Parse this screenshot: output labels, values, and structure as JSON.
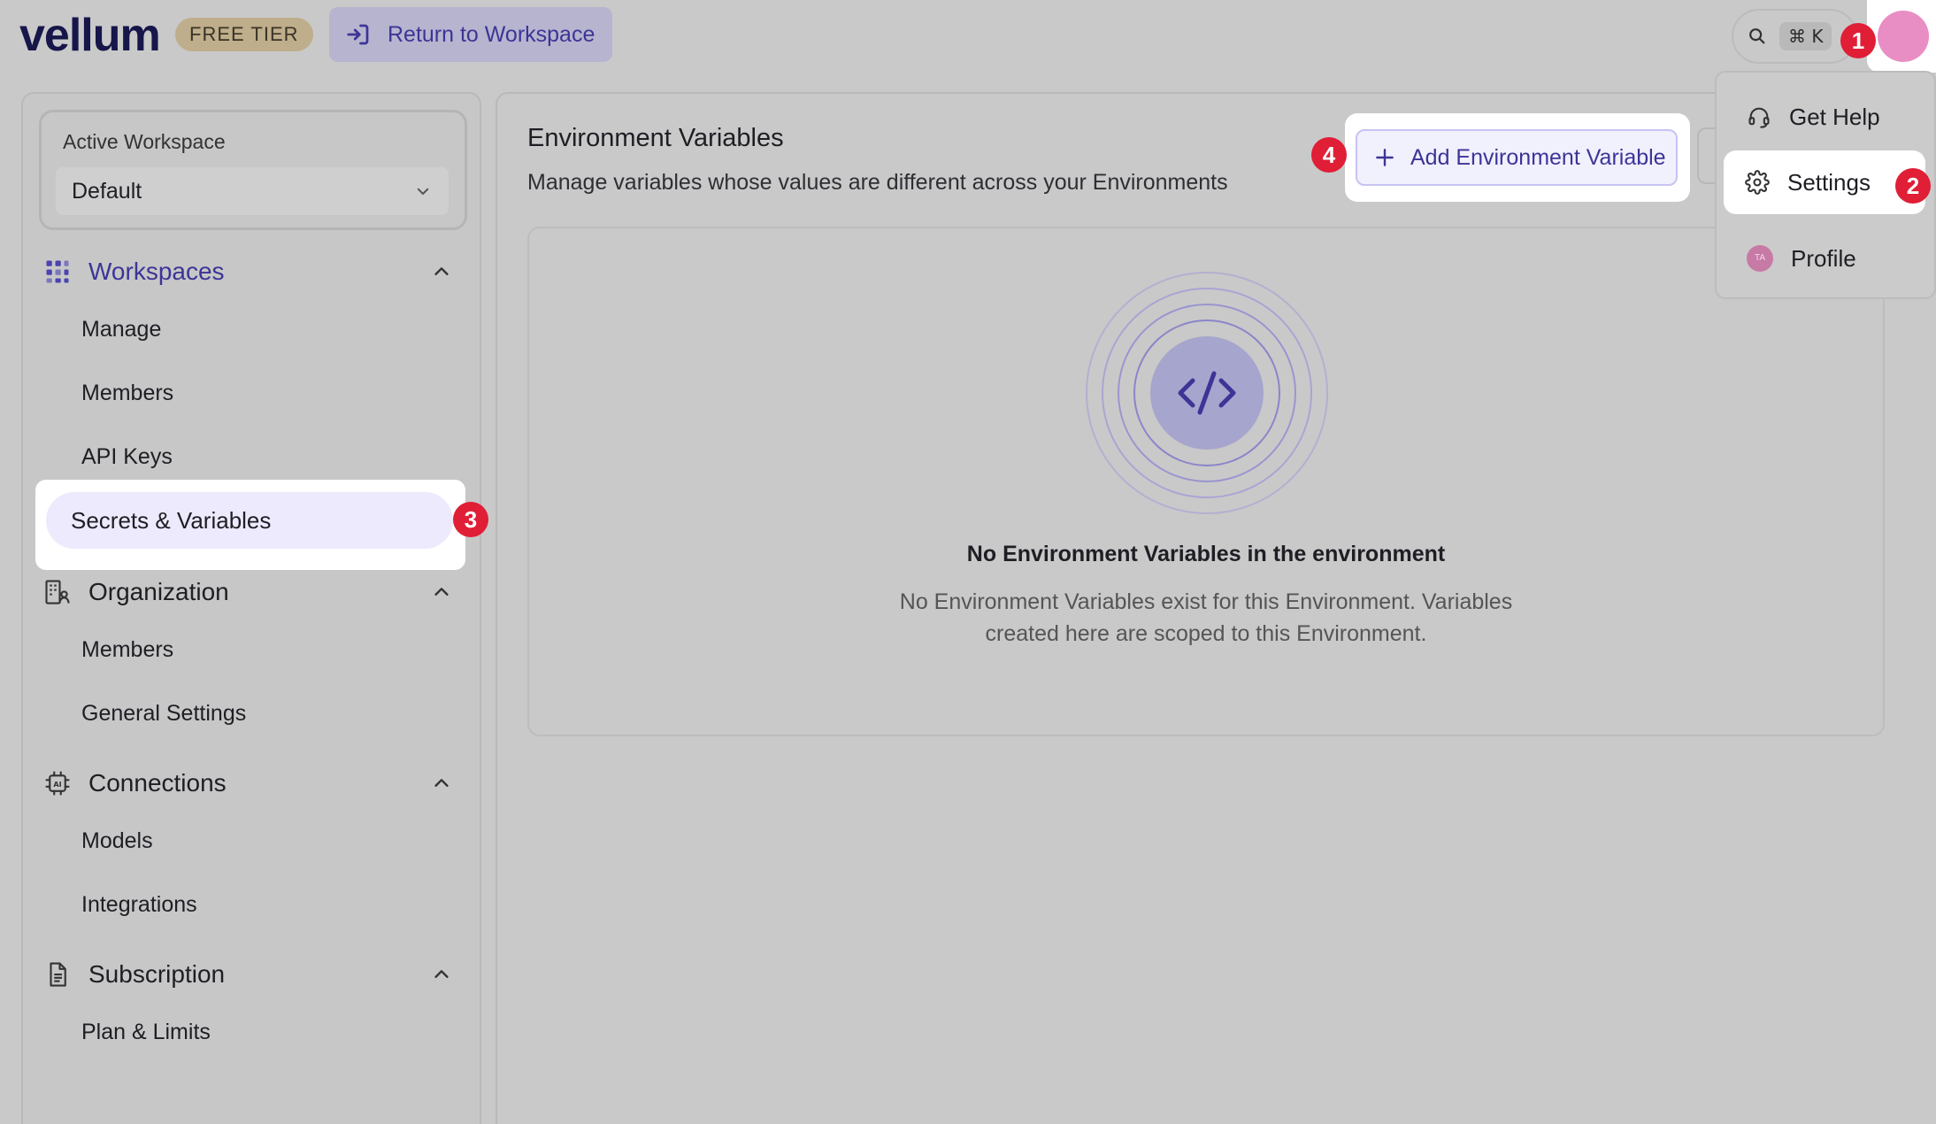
{
  "header": {
    "logo": "vellum",
    "tier": "FREE TIER",
    "return_label": "Return to Workspace",
    "search_shortcut": "⌘ K"
  },
  "sidebar": {
    "workspace_label": "Active Workspace",
    "workspace_value": "Default",
    "sections": [
      {
        "title": "Workspaces",
        "items": [
          "Manage",
          "Members",
          "API Keys",
          "Secrets & Variables"
        ]
      },
      {
        "title": "Organization",
        "items": [
          "Members",
          "General Settings"
        ]
      },
      {
        "title": "Connections",
        "items": [
          "Models",
          "Integrations"
        ]
      },
      {
        "title": "Subscription",
        "items": [
          "Plan & Limits"
        ]
      }
    ]
  },
  "main": {
    "title": "Environment Variables",
    "subtitle": "Manage variables whose values are different across your Environments",
    "add_button": "Add Environment Variable",
    "empty_title": "No Environment Variables in the environment",
    "empty_desc_line1": "No Environment Variables exist for this Environment. Variables",
    "empty_desc_line2": "created here are scoped to this Environment."
  },
  "menu": {
    "items": [
      "Get Help",
      "Settings",
      "Profile"
    ],
    "profile_initials": "TA"
  },
  "badges": [
    "1",
    "2",
    "3",
    "4"
  ],
  "colors": {
    "accent": "#3c3597",
    "badge": "#e01e36",
    "avatar": "#e88ec4"
  }
}
